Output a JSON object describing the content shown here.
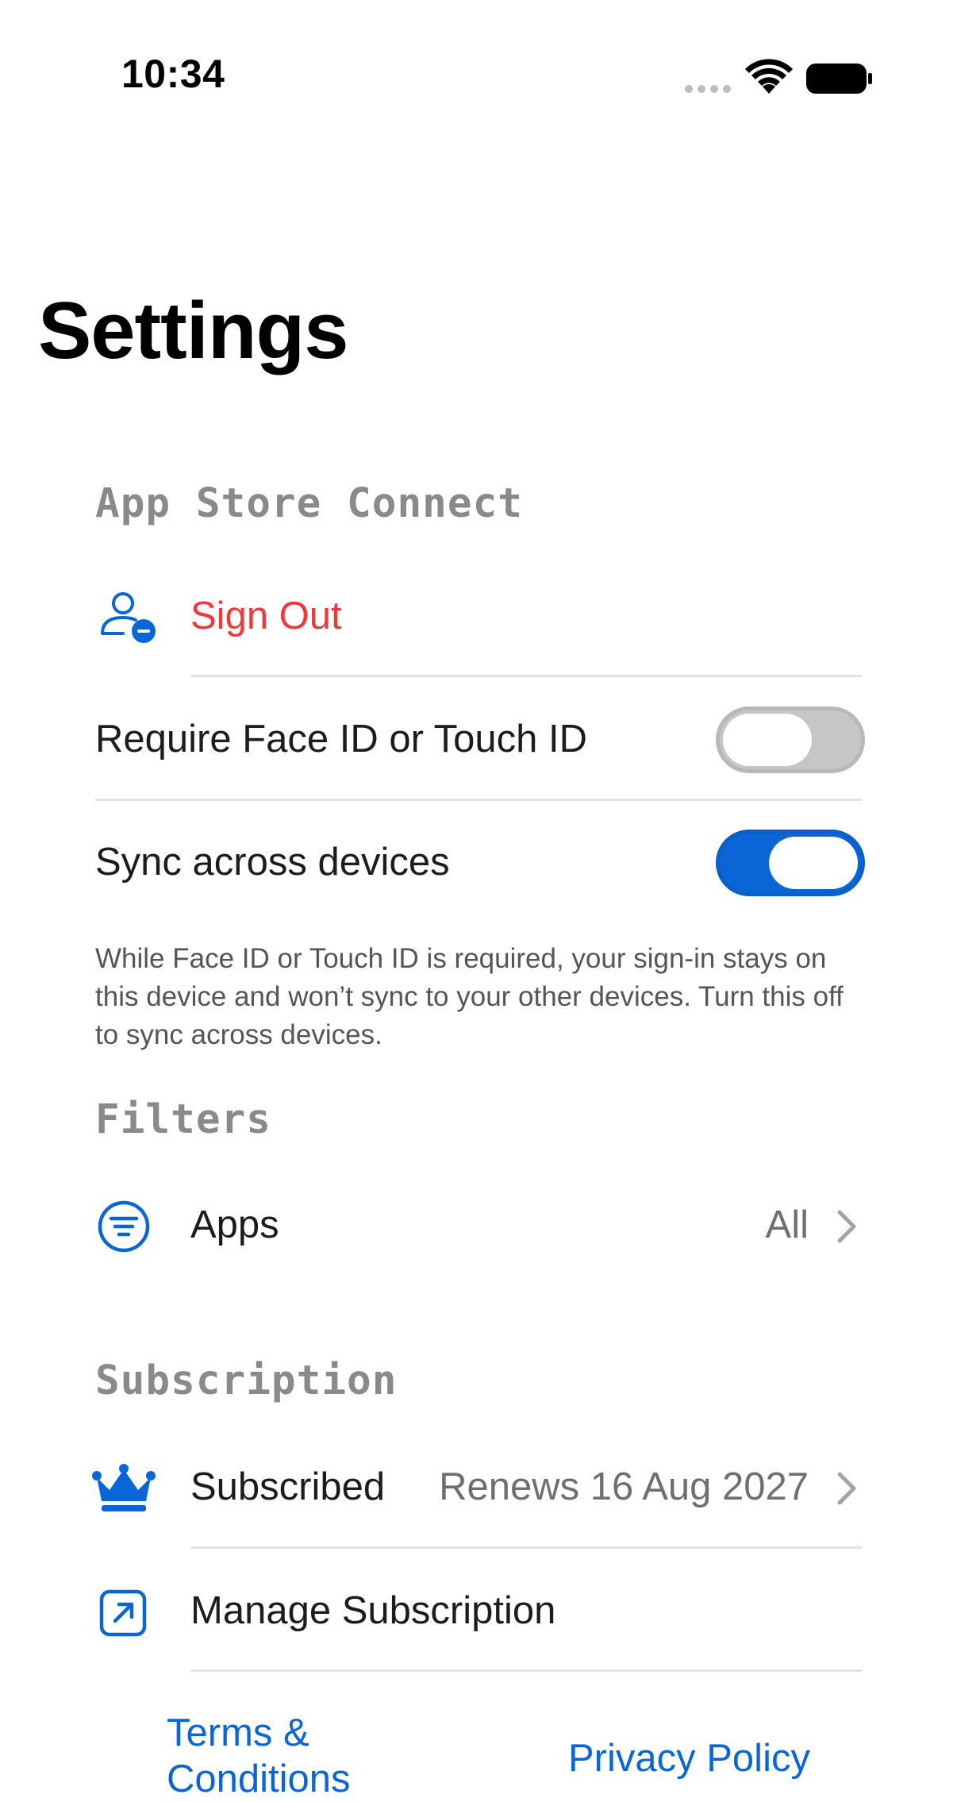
{
  "status_bar": {
    "time": "10:34",
    "icons": [
      "signal-dots-icon",
      "wifi-icon",
      "battery-icon"
    ]
  },
  "page": {
    "title": "Settings"
  },
  "sections": {
    "app_store_connect": {
      "header": "App Store Connect",
      "sign_out": {
        "label": "Sign Out",
        "icon": "person-minus-icon",
        "color": "#f03a3a"
      },
      "require_face_id": {
        "label": "Require Face ID or Touch ID",
        "enabled": false
      },
      "sync_devices": {
        "label": "Sync across devices",
        "enabled": true
      },
      "footnote": "While Face ID or Touch ID is required, your sign-in stays on this device and won’t sync to your other devices. Turn this off to sync across devices."
    },
    "filters": {
      "header": "Filters",
      "apps": {
        "label": "Apps",
        "value": "All",
        "icon": "filter-list-icon"
      }
    },
    "subscription": {
      "header": "Subscription",
      "subscribed": {
        "label": "Subscribed",
        "value": "Renews 16 Aug 2027",
        "icon": "crown-icon"
      },
      "manage": {
        "label": "Manage Subscription",
        "icon": "external-link-square-icon"
      }
    }
  },
  "footer_links": {
    "terms": "Terms & Conditions",
    "privacy": "Privacy Policy"
  },
  "colors": {
    "accent": "#0a66d6",
    "destructive": "#f03a3a",
    "secondary_text": "#6e6e73",
    "section_header": "#8a8a8e",
    "separator": "#e3e3e6"
  }
}
